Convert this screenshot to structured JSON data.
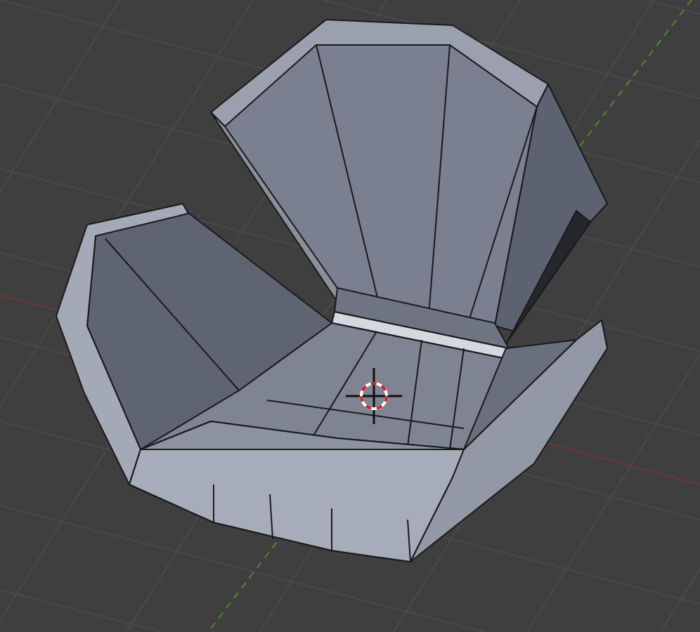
{
  "viewport": {
    "show_grid": true,
    "show_cursor": true
  }
}
